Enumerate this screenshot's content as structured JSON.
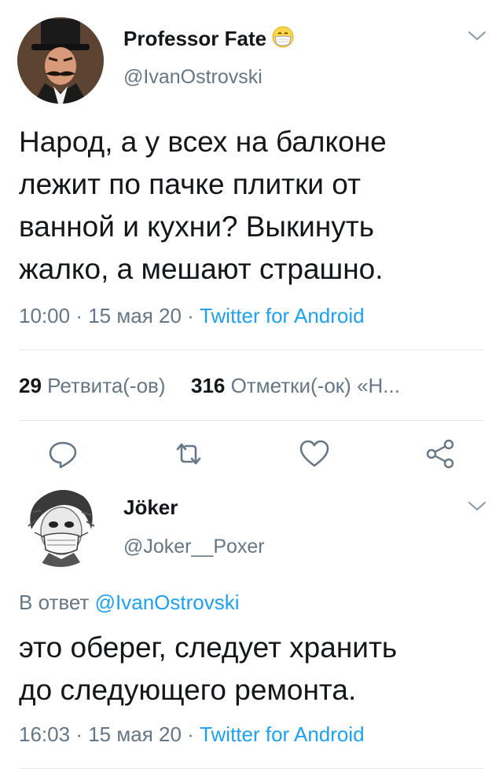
{
  "tweet": {
    "author": {
      "display_name": "Professor Fate",
      "handle": "@IvanOstrovski",
      "badge_icon": "mask-face-emoji-icon"
    },
    "text_lines": [
      "Народ, а у всех на балконе",
      "лежит по пачке плитки от",
      "ванной и кухни? Выкинуть",
      "жалко, а мешают страшно."
    ],
    "time": "10:00",
    "date": "15 мая 20",
    "sep": "·",
    "source": "Twitter for Android",
    "retweets_count": "29",
    "retweets_label": "Ретвита(-ов)",
    "likes_count": "316",
    "likes_label": "Отметки(-ок) «Н..."
  },
  "reply": {
    "author": {
      "display_name": "Jöker",
      "handle": "@Joker__Poxer"
    },
    "in_reply_prefix": "В ответ",
    "in_reply_handle": "@IvanOstrovski",
    "text_lines": [
      "это оберег, следует хранить",
      "до следующего ремонта."
    ],
    "time": "16:03",
    "date": "15 мая 20",
    "sep": "·",
    "source": "Twitter for Android"
  },
  "colors": {
    "accent": "#1da1f2",
    "secondary_text": "#657786",
    "primary_text": "#14171a",
    "divider": "#e1e8ed"
  }
}
